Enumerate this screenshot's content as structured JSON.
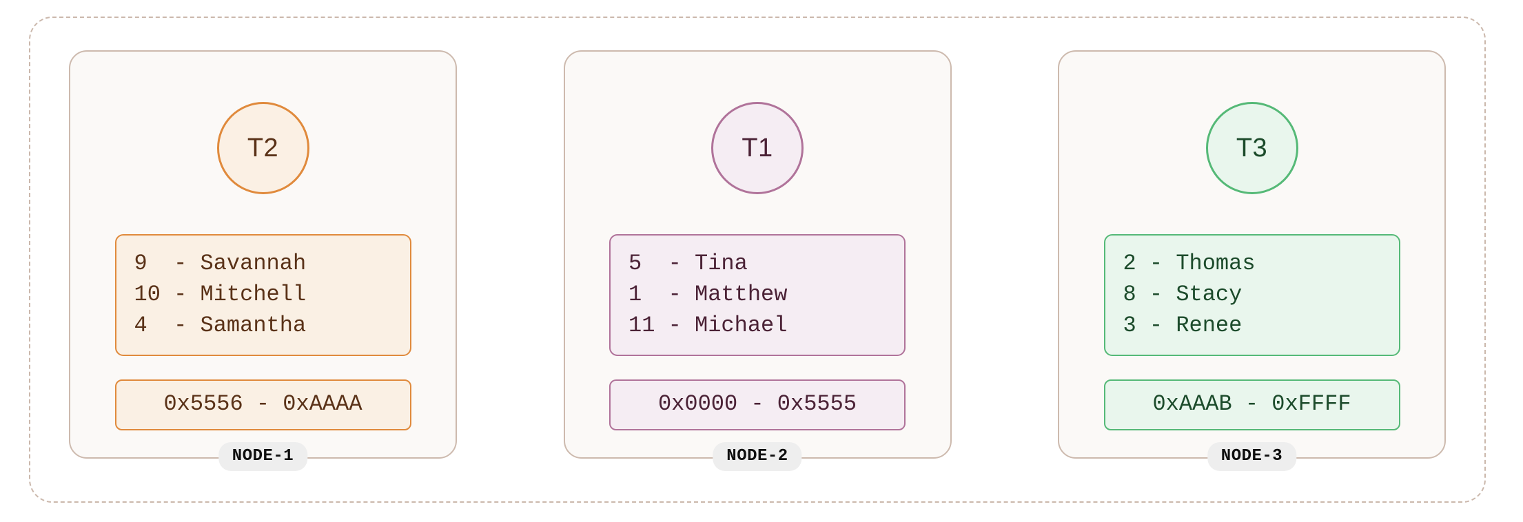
{
  "diagram": {
    "type": "distributed-hash-ring-node-cluster",
    "container": {
      "border_style": "dashed",
      "border_color": "#cbb8ac"
    },
    "theme_colors": {
      "orange_border": "#e08a3c",
      "orange_fill": "#faf0e4",
      "orange_text": "#5a3218",
      "purple_border": "#b0739a",
      "purple_fill": "#f5edf3",
      "purple_text": "#4b2236",
      "green_border": "#55b977",
      "green_fill": "#e9f6ed",
      "green_text": "#1c4b2b",
      "card_border": "#cdbaae",
      "card_fill": "#fbf9f7",
      "badge_fill": "#eeeeee"
    },
    "nodes": [
      {
        "badge_label": "NODE-1",
        "token_label": "T2",
        "theme": "orange",
        "entries": [
          "9  - Savannah",
          "10 - Mitchell",
          "4  - Samantha"
        ],
        "range": "0x5556 - 0xAAAA"
      },
      {
        "badge_label": "NODE-2",
        "token_label": "T1",
        "theme": "purple",
        "entries": [
          "5  - Tina",
          "1  - Matthew",
          "11 - Michael"
        ],
        "range": "0x0000 - 0x5555"
      },
      {
        "badge_label": "NODE-3",
        "token_label": "T3",
        "theme": "green",
        "entries": [
          "2 - Thomas",
          "8 - Stacy",
          "3 - Renee"
        ],
        "range": "0xAAAB - 0xFFFF"
      }
    ]
  }
}
